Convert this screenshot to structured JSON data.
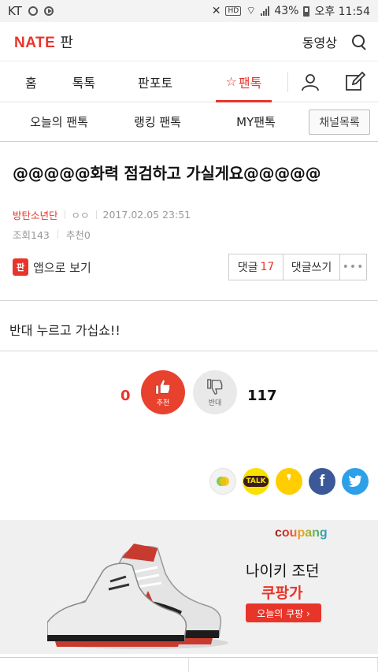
{
  "status": {
    "carrier": "KT",
    "battery": "43%",
    "time": "오후 11:54"
  },
  "header": {
    "logo": "NATE",
    "section": "판",
    "video": "동영상"
  },
  "tabs": [
    "홈",
    "톡톡",
    "판포토",
    "팬톡"
  ],
  "subnav": [
    "오늘의 팬톡",
    "랭킹 팬톡",
    "MY팬톡"
  ],
  "channel_list": "채널목록",
  "article": {
    "title": "@@@@@화력 점검하고 가실게요@@@@@",
    "author": "방탄소년단",
    "nick": "ㅇㅇ",
    "date": "2017.02.05 23:51",
    "views_label": "조회",
    "views": "143",
    "rec_label": "추천",
    "rec": "0",
    "app_view": "앱으로 보기",
    "comment_label": "댓글",
    "comment_count": "17",
    "write_comment": "댓글쓰기",
    "more": "•••",
    "body": "반대 누르고 가십쇼!!"
  },
  "votes": {
    "up_count": "0",
    "up_label": "추천",
    "down_label": "반대",
    "down_count": "117"
  },
  "ad": {
    "brand": "coupang",
    "line1": "나이키 조던",
    "line2": "쿠팡가",
    "cta": "오늘의 쿠팡 ›"
  }
}
